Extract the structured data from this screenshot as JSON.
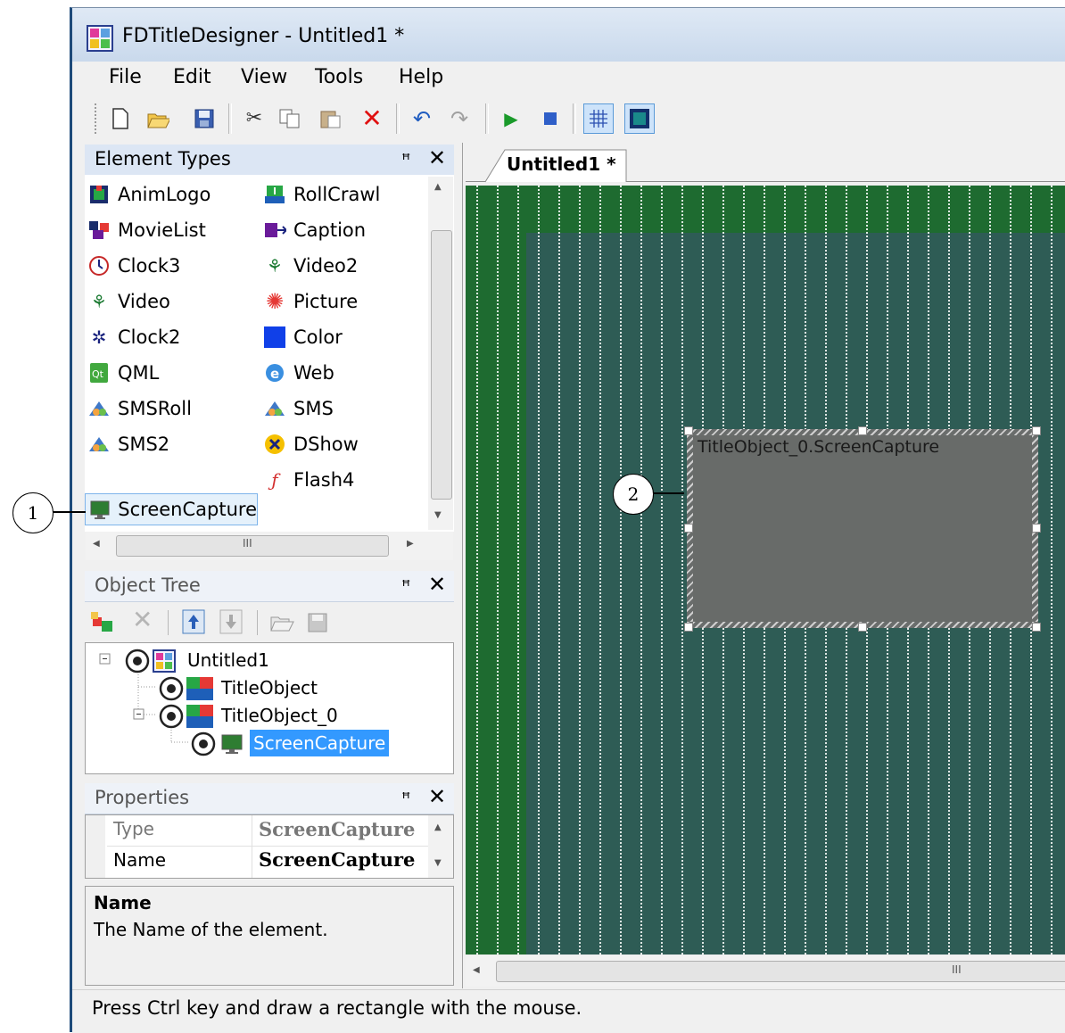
{
  "window": {
    "title": "FDTitleDesigner - Untitled1 *"
  },
  "menu": [
    "File",
    "Edit",
    "View",
    "Tools",
    "Help"
  ],
  "toolbar_icons": [
    "new-icon",
    "open-icon",
    "save-icon",
    "cut-icon",
    "copy-icon",
    "paste-icon",
    "delete-icon",
    "undo-icon",
    "redo-icon",
    "play-icon",
    "stop-icon",
    "grid-icon",
    "background-icon"
  ],
  "element_types": {
    "title": "Element Types",
    "items_left": [
      "AnimLogo",
      "MovieList",
      "Clock3",
      "Video",
      "Clock2",
      "QML",
      "SMSRoll",
      "SMS2",
      "ScreenCapture"
    ],
    "items_right": [
      "RollCrawl",
      "Caption",
      "Video2",
      "Picture",
      "Color",
      "Web",
      "SMS",
      "DShow",
      "Flash4"
    ],
    "scroll_glyph": "III"
  },
  "object_tree": {
    "title": "Object Tree",
    "nodes": [
      "Untitled1",
      "TitleObject",
      "TitleObject_0",
      "ScreenCapture"
    ]
  },
  "properties": {
    "title": "Properties",
    "rows": [
      {
        "name": "Type",
        "value": "ScreenCapture"
      },
      {
        "name": "Name",
        "value": "ScreenCapture"
      }
    ],
    "desc_title": "Name",
    "desc_text": "The Name of the element."
  },
  "editor": {
    "tab": "Untitled1 *",
    "object_label": "TitleObject_0.ScreenCapture",
    "scroll_glyph": "III"
  },
  "status": "Press Ctrl key and draw a rectangle with the mouse.",
  "callouts": [
    "1",
    "2"
  ],
  "colors": {
    "canvas_outer": "#1e6b30",
    "canvas_inner": "#2e5c55",
    "selection": "#3399ff"
  }
}
